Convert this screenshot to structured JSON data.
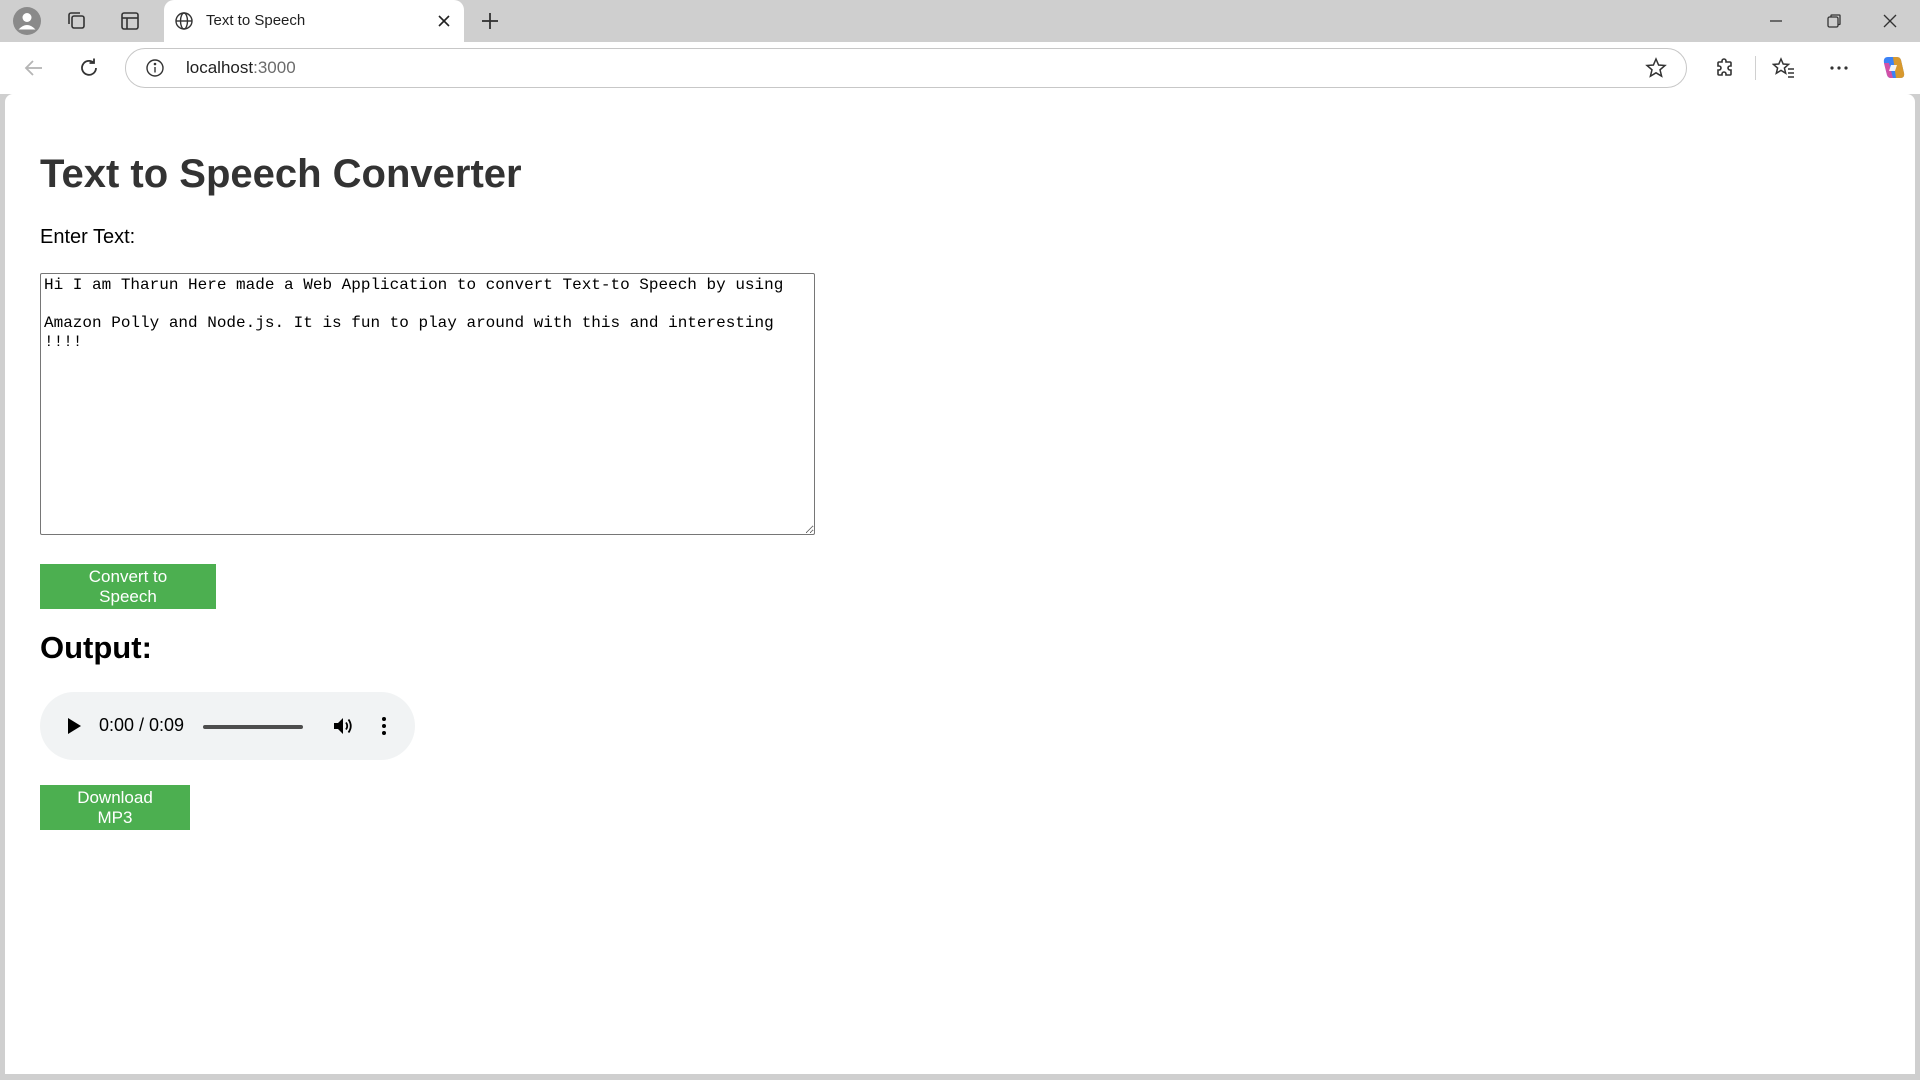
{
  "browser": {
    "tab_title": "Text to Speech",
    "url_host": "localhost",
    "url_port": ":3000",
    "icons": [
      "profile-icon",
      "workspaces-icon",
      "tab-actions-icon",
      "globe-icon",
      "close-icon",
      "new-tab-icon",
      "minimize-icon",
      "restore-icon",
      "window-close-icon",
      "back-icon",
      "refresh-icon",
      "site-info-icon",
      "favorite-star-icon",
      "extensions-icon",
      "favorites-icon",
      "more-icon",
      "copilot-icon"
    ]
  },
  "page": {
    "heading": "Text to Speech Converter",
    "input_label": "Enter Text:",
    "textarea_value": "Hi I am Tharun Here made a Web Application to convert Text-to Speech by using \n\nAmazon Polly and Node.js. It is fun to play around with this and interesting !!!!",
    "convert_label": "Convert to Speech",
    "output_heading": "Output:",
    "audio": {
      "time": "0:00 / 0:09"
    },
    "download_label": "Download MP3"
  },
  "colors": {
    "button_green": "#4caf50",
    "heading_color": "#333333",
    "audio_bg": "#f1f3f4"
  }
}
